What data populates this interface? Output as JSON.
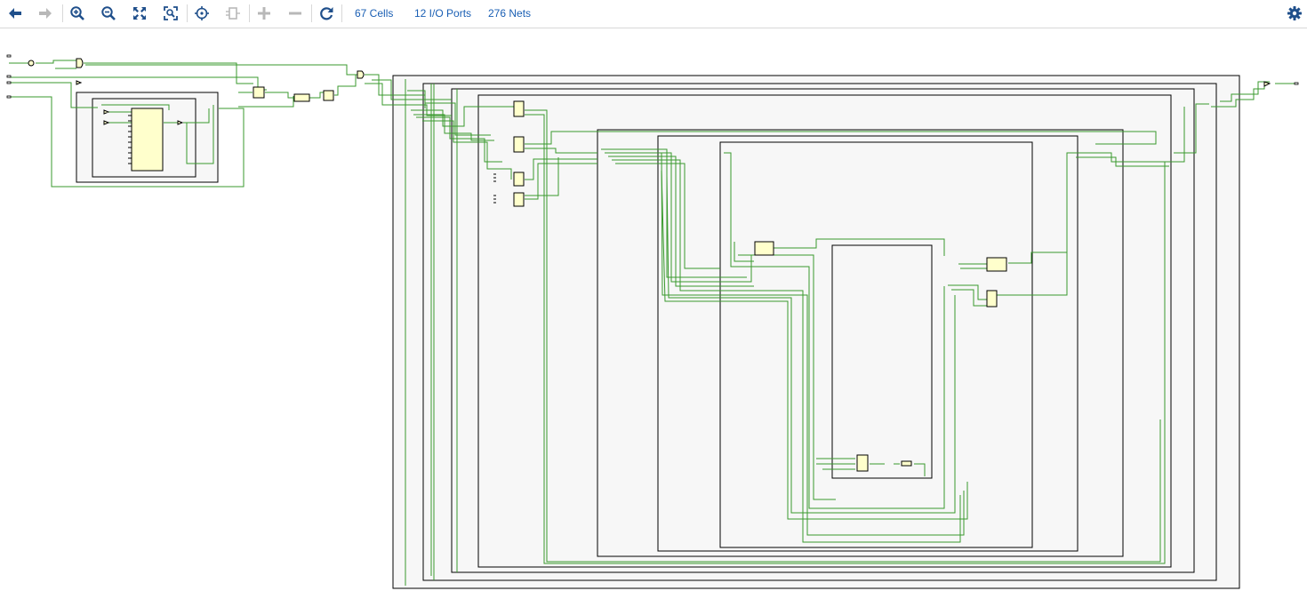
{
  "toolbar": {
    "buttons": [
      {
        "name": "back-button",
        "icon": "arrow-left-icon",
        "enabled": true
      },
      {
        "name": "forward-button",
        "icon": "arrow-right-icon",
        "enabled": false
      },
      {
        "name": "zoom-in-button",
        "icon": "zoom-in-icon",
        "enabled": true
      },
      {
        "name": "zoom-out-button",
        "icon": "zoom-out-icon",
        "enabled": true
      },
      {
        "name": "zoom-fit-button",
        "icon": "fit-icon",
        "enabled": true
      },
      {
        "name": "zoom-selection-button",
        "icon": "zoom-area-icon",
        "enabled": true
      },
      {
        "name": "auto-fit-button",
        "icon": "crosshair-icon",
        "enabled": true
      },
      {
        "name": "regenerate-button",
        "icon": "cell-icon",
        "enabled": false
      },
      {
        "name": "expand-button",
        "icon": "plus-icon",
        "enabled": false
      },
      {
        "name": "collapse-button",
        "icon": "minus-icon",
        "enabled": false
      },
      {
        "name": "reload-button",
        "icon": "refresh-icon",
        "enabled": true
      }
    ],
    "cells_label": "67 Cells",
    "ports_label": "12 I/O Ports",
    "nets_label": "276 Nets",
    "settings_icon": "gear-icon"
  },
  "colors": {
    "icon": "#1f4f8b",
    "icon_disabled": "#b8b8b8",
    "link": "#1a5fb4",
    "wire": "#3a9a2e",
    "hier_fill": "#f7f7f7",
    "cell_fill": "#ffffcc",
    "outline": "#000000"
  }
}
